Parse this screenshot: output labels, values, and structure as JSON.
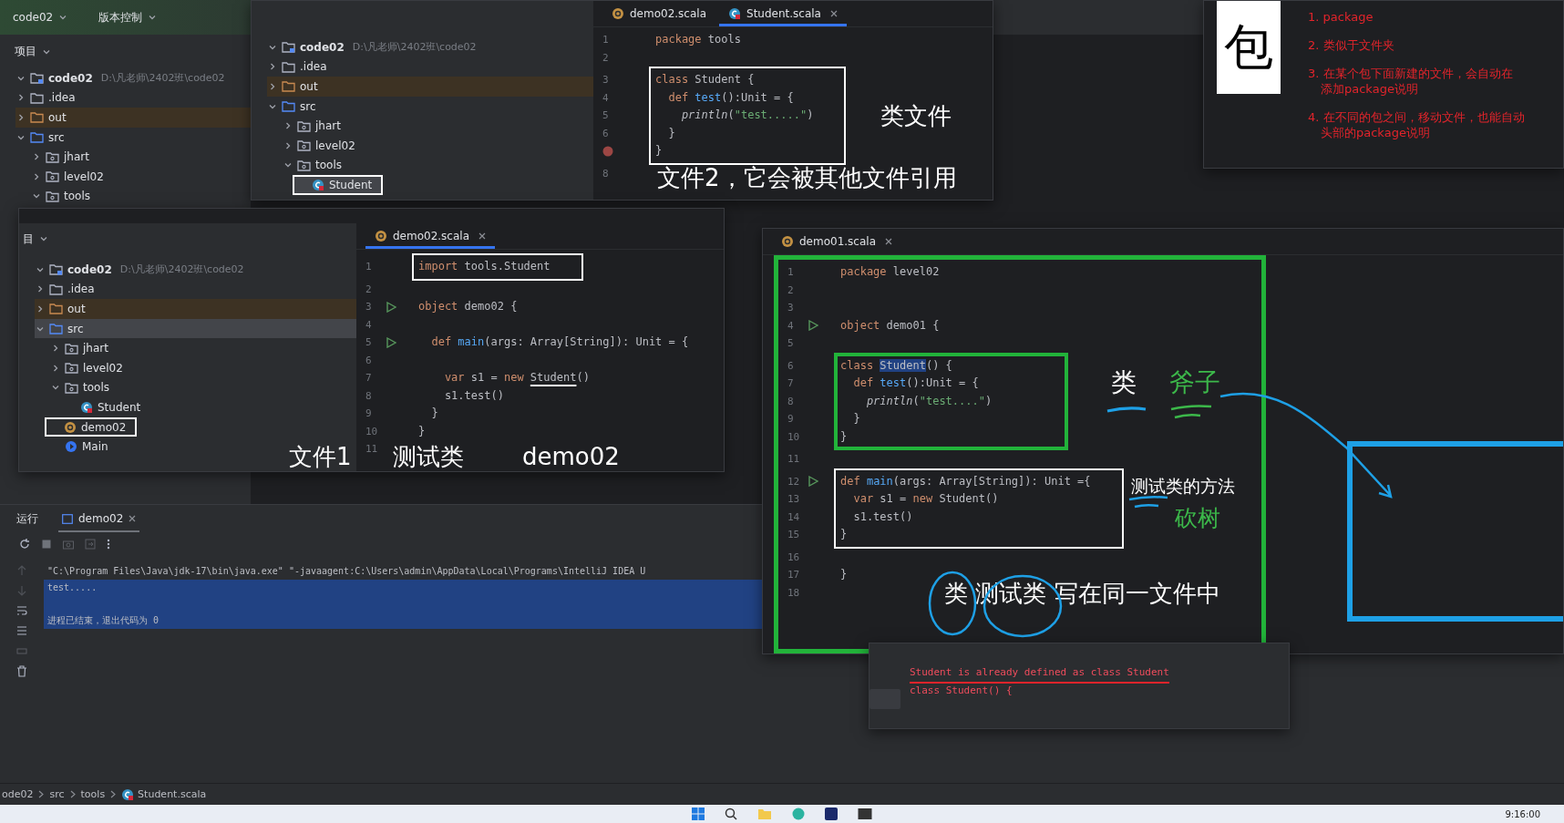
{
  "ide": {
    "project_name": "code02",
    "vcs_label": "版本控制",
    "project_panel_title": "项目",
    "tree": [
      {
        "label": "code02",
        "path": "D:\\凡老师\\2402班\\code02",
        "kind": "module",
        "expanded": true,
        "selected": false,
        "children": [
          {
            "label": ".idea",
            "kind": "folder",
            "expanded": false,
            "selected": false
          },
          {
            "label": "out",
            "kind": "excluded",
            "expanded": false,
            "selected": false
          },
          {
            "label": "src",
            "kind": "source",
            "expanded": true,
            "selected": false,
            "children": [
              {
                "label": "jhart",
                "kind": "package",
                "expanded": false,
                "selected": false
              },
              {
                "label": "level02",
                "kind": "package",
                "expanded": false,
                "selected": false
              },
              {
                "label": "tools",
                "kind": "package",
                "expanded": true,
                "selected": false
              }
            ]
          }
        ]
      }
    ],
    "run_panel": {
      "title": "运行",
      "tabs": [
        {
          "label": "demo02",
          "selected": true
        }
      ],
      "console": [
        {
          "text": "\"C:\\Program Files\\Java\\jdk-17\\bin\\java.exe\" \"-javaagent:C:\\Users\\admin\\AppData\\Local\\Programs\\IntelliJ IDEA U",
          "selected": false,
          "kind": "command"
        },
        {
          "text": "test.....",
          "selected": true,
          "kind": "output"
        },
        {
          "text": "进程已结束，退出代码为 0",
          "selected": true,
          "kind": "exit_status"
        }
      ]
    },
    "breadcrumb": [
      "ode02",
      "src",
      "tools",
      "Student.scala"
    ],
    "taskbar": {
      "time": "9:16:00"
    }
  },
  "windows": [
    {
      "kind": "ide_snippet",
      "tree": [
        {
          "label": "code02",
          "path": "D:\\凡老师\\2402班\\code02",
          "kind": "module",
          "expanded": true,
          "selected": false,
          "children": [
            {
              "label": ".idea",
              "kind": "folder",
              "expanded": false,
              "selected": false
            },
            {
              "label": "out",
              "kind": "excluded",
              "expanded": false,
              "selected": false
            },
            {
              "label": "src",
              "kind": "source",
              "expanded": true,
              "selected": false,
              "children": [
                {
                  "label": "jhart",
                  "kind": "package",
                  "expanded": false,
                  "selected": false
                },
                {
                  "label": "level02",
                  "kind": "package",
                  "expanded": false,
                  "selected": false
                },
                {
                  "label": "tools",
                  "kind": "package",
                  "expanded": true,
                  "selected": false,
                  "children": [
                    {
                      "label": "Student",
                      "kind": "class",
                      "selected": true,
                      "boxed": true
                    }
                  ]
                }
              ]
            }
          ]
        }
      ],
      "tabs": [
        {
          "label": "demo02.scala",
          "kind": "object",
          "selected": false
        },
        {
          "label": "Student.scala",
          "kind": "class",
          "selected": true
        }
      ],
      "code": [
        {
          "kind": "plain",
          "lines": [
            {
              "n": "1",
              "code": [
                {
                  "text": "package",
                  "kind": "kw"
                },
                {
                  "text": " tools",
                  "kind": "id"
                }
              ]
            },
            {
              "n": "2"
            }
          ]
        },
        {
          "kind": "white_frame",
          "lines": [
            {
              "n": "3",
              "code": [
                {
                  "text": "class",
                  "kind": "kw"
                },
                {
                  "text": " Student {",
                  "kind": "id"
                }
              ]
            },
            {
              "n": "4",
              "code": [
                {
                  "text": "  def ",
                  "kind": "kw"
                },
                {
                  "text": "test",
                  "kind": "fn"
                },
                {
                  "text": "():Unit = {",
                  "kind": "id"
                }
              ]
            },
            {
              "n": "5",
              "code": [
                {
                  "text": "    println",
                  "kind": "it"
                },
                {
                  "text": "(",
                  "kind": "id"
                },
                {
                  "text": "\"test.....\"",
                  "kind": "str"
                },
                {
                  "text": ")",
                  "kind": "id"
                }
              ]
            },
            {
              "n": "6",
              "code": [
                {
                  "text": "  }",
                  "kind": "id"
                }
              ]
            },
            {
              "breakpoint": true,
              "code": [
                {
                  "text": "}",
                  "kind": "id"
                }
              ]
            }
          ]
        },
        {
          "kind": "plain",
          "lines": [
            {
              "n": "8"
            }
          ]
        }
      ],
      "annotations": [
        {
          "text": "类文件",
          "color": "#ffffff"
        },
        {
          "text": "文件2，它会被其他文件引用",
          "color": "#ffffff"
        }
      ]
    },
    {
      "kind": "notes",
      "glyph": "包",
      "items": [
        {
          "lines": [
            "1.  package"
          ]
        },
        {
          "lines": [
            "2. 类似于文件夹"
          ]
        },
        {
          "lines": [
            "3. 在某个包下面新建的文件，会自动在",
            "添加package说明"
          ]
        },
        {
          "lines": [
            "4. 在不同的包之间，移动文件，也能自动",
            "头部的package说明"
          ]
        }
      ]
    },
    {
      "kind": "ide_snippet",
      "tree_title": "目",
      "tree": [
        {
          "label": "code02",
          "path": "D:\\凡老师\\2402班\\code02",
          "kind": "module",
          "expanded": true,
          "selected": false,
          "children": [
            {
              "label": ".idea",
              "kind": "folder",
              "expanded": false,
              "selected": false
            },
            {
              "label": "out",
              "kind": "excluded",
              "expanded": false,
              "selected": false
            },
            {
              "label": "src",
              "kind": "source",
              "expanded": true,
              "selected": true,
              "children": [
                {
                  "label": "jhart",
                  "kind": "package",
                  "expanded": false,
                  "selected": false
                },
                {
                  "label": "level02",
                  "kind": "package",
                  "expanded": false,
                  "selected": false
                },
                {
                  "label": "tools",
                  "kind": "package",
                  "expanded": true,
                  "selected": false,
                  "children": [
                    {
                      "label": "Student",
                      "kind": "class",
                      "selected": false
                    }
                  ]
                },
                {
                  "label": "demo02",
                  "kind": "object",
                  "selected": false,
                  "boxed": true
                },
                {
                  "label": "Main",
                  "kind": "main",
                  "selected": false
                }
              ]
            }
          ]
        }
      ],
      "tabs": [
        {
          "label": "demo02.scala",
          "kind": "object",
          "selected": true
        }
      ],
      "code": [
        {
          "kind": "white_frame",
          "lines": [
            {
              "n": "1",
              "code": [
                {
                  "text": "import",
                  "kind": "kw"
                },
                {
                  "text": " tools.Student",
                  "kind": "id"
                }
              ]
            }
          ]
        },
        {
          "kind": "plain",
          "lines": [
            {
              "n": "2"
            },
            {
              "n": "3",
              "run": true,
              "code": [
                {
                  "text": "object",
                  "kind": "kw"
                },
                {
                  "text": " demo02 {",
                  "kind": "id"
                }
              ]
            },
            {
              "n": "4"
            },
            {
              "n": "5",
              "run": true,
              "code": [
                {
                  "text": "  def ",
                  "kind": "kw"
                },
                {
                  "text": "main",
                  "kind": "fn"
                },
                {
                  "text": "(args: Array[String]): Unit = {",
                  "kind": "id"
                }
              ]
            },
            {
              "n": "6"
            },
            {
              "n": "7",
              "code": [
                {
                  "text": "    var",
                  "kind": "kw"
                },
                {
                  "text": " s1 = ",
                  "kind": "id"
                },
                {
                  "text": "new ",
                  "kind": "kw"
                },
                {
                  "text": "Student",
                  "kind": "ul"
                },
                {
                  "text": "()",
                  "kind": "id"
                }
              ]
            },
            {
              "n": "8",
              "code": [
                {
                  "text": "    s1.test()",
                  "kind": "id"
                }
              ]
            },
            {
              "n": "9",
              "code": [
                {
                  "text": "  }",
                  "kind": "id"
                }
              ]
            },
            {
              "n": "10",
              "code": [
                {
                  "text": "}",
                  "kind": "id"
                }
              ]
            },
            {
              "n": "11"
            }
          ]
        }
      ],
      "annotations": [
        {
          "text": "文件1",
          "color": "#ffffff"
        },
        {
          "text": "测试类",
          "color": "#ffffff"
        },
        {
          "text": "demo02",
          "color": "#ffffff"
        }
      ]
    },
    {
      "kind": "ide_snippet",
      "outlined": true,
      "tabs": [
        {
          "label": "demo01.scala",
          "kind": "object",
          "selected": false
        }
      ],
      "code": [
        {
          "kind": "plain",
          "lines": [
            {
              "n": "1",
              "code": [
                {
                  "text": "package",
                  "kind": "kw"
                },
                {
                  "text": " level02",
                  "kind": "id"
                }
              ]
            },
            {
              "n": "2"
            },
            {
              "n": "3"
            },
            {
              "n": "4",
              "run": true,
              "code": [
                {
                  "text": "object",
                  "kind": "kw"
                },
                {
                  "text": " demo01 {",
                  "kind": "id"
                }
              ]
            },
            {
              "n": "5"
            }
          ]
        },
        {
          "kind": "green_frame",
          "lines": [
            {
              "n": "6",
              "code": [
                {
                  "text": "class ",
                  "kind": "kw"
                },
                {
                  "text": "Student",
                  "kind": "sel"
                },
                {
                  "text": "() {",
                  "kind": "id"
                }
              ]
            },
            {
              "n": "7",
              "code": [
                {
                  "text": "  def ",
                  "kind": "kw"
                },
                {
                  "text": "test",
                  "kind": "fn"
                },
                {
                  "text": "():Unit = {",
                  "kind": "id"
                }
              ]
            },
            {
              "n": "8",
              "code": [
                {
                  "text": "    println",
                  "kind": "it"
                },
                {
                  "text": "(",
                  "kind": "id"
                },
                {
                  "text": "\"test....\"",
                  "kind": "str"
                },
                {
                  "text": ")",
                  "kind": "id"
                }
              ]
            },
            {
              "n": "9",
              "code": [
                {
                  "text": "  }",
                  "kind": "id"
                }
              ]
            },
            {
              "n": "10",
              "code": [
                {
                  "text": "}",
                  "kind": "id"
                }
              ]
            }
          ]
        },
        {
          "kind": "plain",
          "lines": [
            {
              "n": "11"
            }
          ]
        },
        {
          "kind": "white_frame",
          "lines": [
            {
              "n": "12",
              "run": true,
              "code": [
                {
                  "text": "def ",
                  "kind": "kw"
                },
                {
                  "text": "main",
                  "kind": "fn"
                },
                {
                  "text": "(args: Array[String]): Unit ={",
                  "kind": "id"
                }
              ]
            },
            {
              "n": "13",
              "code": [
                {
                  "text": "  var",
                  "kind": "kw"
                },
                {
                  "text": " s1 = ",
                  "kind": "id"
                },
                {
                  "text": "new",
                  "kind": "kw"
                },
                {
                  "text": " Student()",
                  "kind": "id"
                }
              ]
            },
            {
              "n": "14",
              "code": [
                {
                  "text": "  s1.test()",
                  "kind": "id"
                }
              ]
            },
            {
              "n": "15",
              "code": [
                {
                  "text": "}",
                  "kind": "id"
                }
              ]
            }
          ]
        },
        {
          "kind": "plain",
          "lines": [
            {
              "n": "16"
            },
            {
              "n": "17",
              "code": [
                {
                  "text": "}",
                  "kind": "id"
                }
              ]
            },
            {
              "n": "18"
            }
          ]
        }
      ],
      "annotations": [
        {
          "text": "类",
          "color": "#ffffff"
        },
        {
          "text": "斧子",
          "color": "#3cb84a"
        },
        {
          "text": "测试类的方法",
          "color": "#ffffff"
        },
        {
          "text": "砍树",
          "color": "#3cb84a"
        },
        {
          "text": "类  测试类 写在同一文件中",
          "color": "#ffffff"
        }
      ]
    },
    {
      "kind": "popup",
      "lines": [
        {
          "text": "Student is already defined as class Student",
          "underlined": true
        },
        {
          "text": "class Student() {",
          "underlined": false
        }
      ]
    }
  ]
}
